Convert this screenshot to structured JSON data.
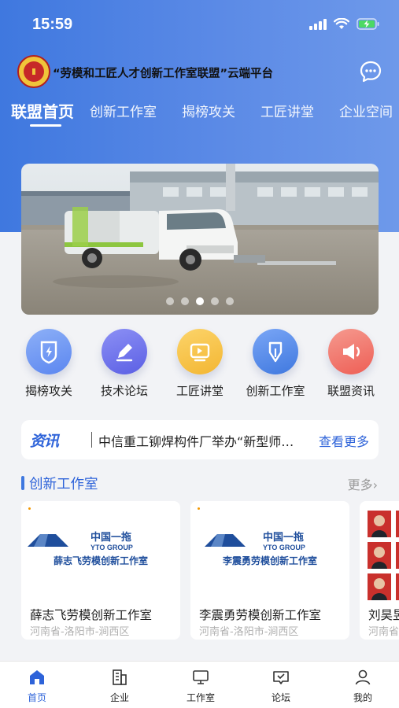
{
  "status": {
    "time": "15:59"
  },
  "app": {
    "title": "“劳模和工匠人才创新工作室联盟”云端平台"
  },
  "tabs": [
    {
      "label": "联盟首页",
      "active": true
    },
    {
      "label": "创新工作室"
    },
    {
      "label": "揭榜攻关"
    },
    {
      "label": "工匠讲堂"
    },
    {
      "label": "企业空间"
    }
  ],
  "banner": {
    "page_count": 5,
    "active_index": 2
  },
  "quick_links": [
    {
      "label": "揭榜攻关",
      "icon": "shield-lightning-icon",
      "color": "#5b86f0"
    },
    {
      "label": "技术论坛",
      "icon": "edit-pencil-icon",
      "color": "#5b5fe4"
    },
    {
      "label": "工匠讲堂",
      "icon": "video-play-icon",
      "color": "#f3b632"
    },
    {
      "label": "创新工作室",
      "icon": "pen-nib-icon",
      "color": "#3f78df"
    },
    {
      "label": "联盟资讯",
      "icon": "speaker-icon",
      "color": "#ee5e55"
    }
  ],
  "news": {
    "tag": "资讯",
    "text": "中信重工铆焊构件厂举办“新型师…",
    "more": "查看更多"
  },
  "studios": {
    "title": "创新工作室",
    "more": "更多",
    "cards": [
      {
        "logo_cn": "中国一拖",
        "logo_en": "YTO GROUP",
        "logo_sub": "薛志飞劳模创新工作室",
        "name": "薛志飞劳模创新工作室",
        "location": "河南省-洛阳市-涧西区"
      },
      {
        "logo_cn": "中国一拖",
        "logo_en": "YTO GROUP",
        "logo_sub": "李震勇劳模创新工作室",
        "name": "李震勇劳模创新工作室",
        "location": "河南省-洛阳市-涧西区"
      },
      {
        "name": "刘昊昱",
        "location": "河南省"
      }
    ]
  },
  "tabbar": [
    {
      "label": "首页",
      "icon": "home-icon",
      "active": true
    },
    {
      "label": "企业",
      "icon": "building-icon"
    },
    {
      "label": "工作室",
      "icon": "monitor-icon"
    },
    {
      "label": "论坛",
      "icon": "forum-icon"
    },
    {
      "label": "我的",
      "icon": "user-icon"
    }
  ],
  "colors": {
    "primary": "#3f78df",
    "link": "#2e63d9"
  }
}
